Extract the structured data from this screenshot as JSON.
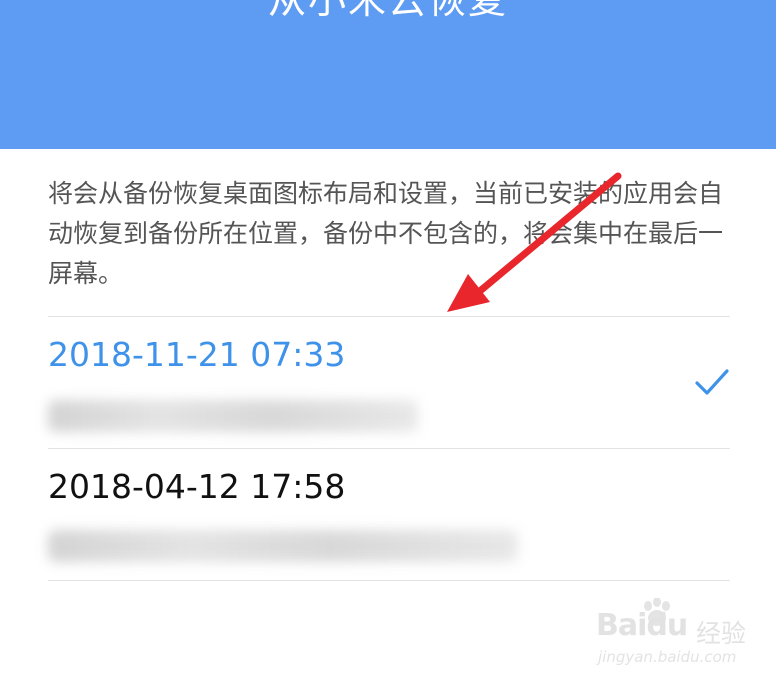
{
  "header": {
    "title": "从小米云恢复"
  },
  "description": "将会从备份恢复桌面图标布局和设置，当前已安装的应用会自动恢复到备份所在位置，备份中不包含的，将会集中在最后一屏幕。",
  "backups": [
    {
      "date": "2018-11-21 07:33",
      "selected": true
    },
    {
      "date": "2018-04-12 17:58",
      "selected": false
    }
  ],
  "watermark": {
    "logo": "Baidu",
    "text": "经验",
    "url": "jingyan.baidu.com"
  },
  "colors": {
    "header_bg": "#5e9bf2",
    "accent": "#3e92e9",
    "arrow": "#e8262c"
  },
  "icons": {
    "check": "check-icon",
    "annotation": "red-arrow-annotation"
  }
}
